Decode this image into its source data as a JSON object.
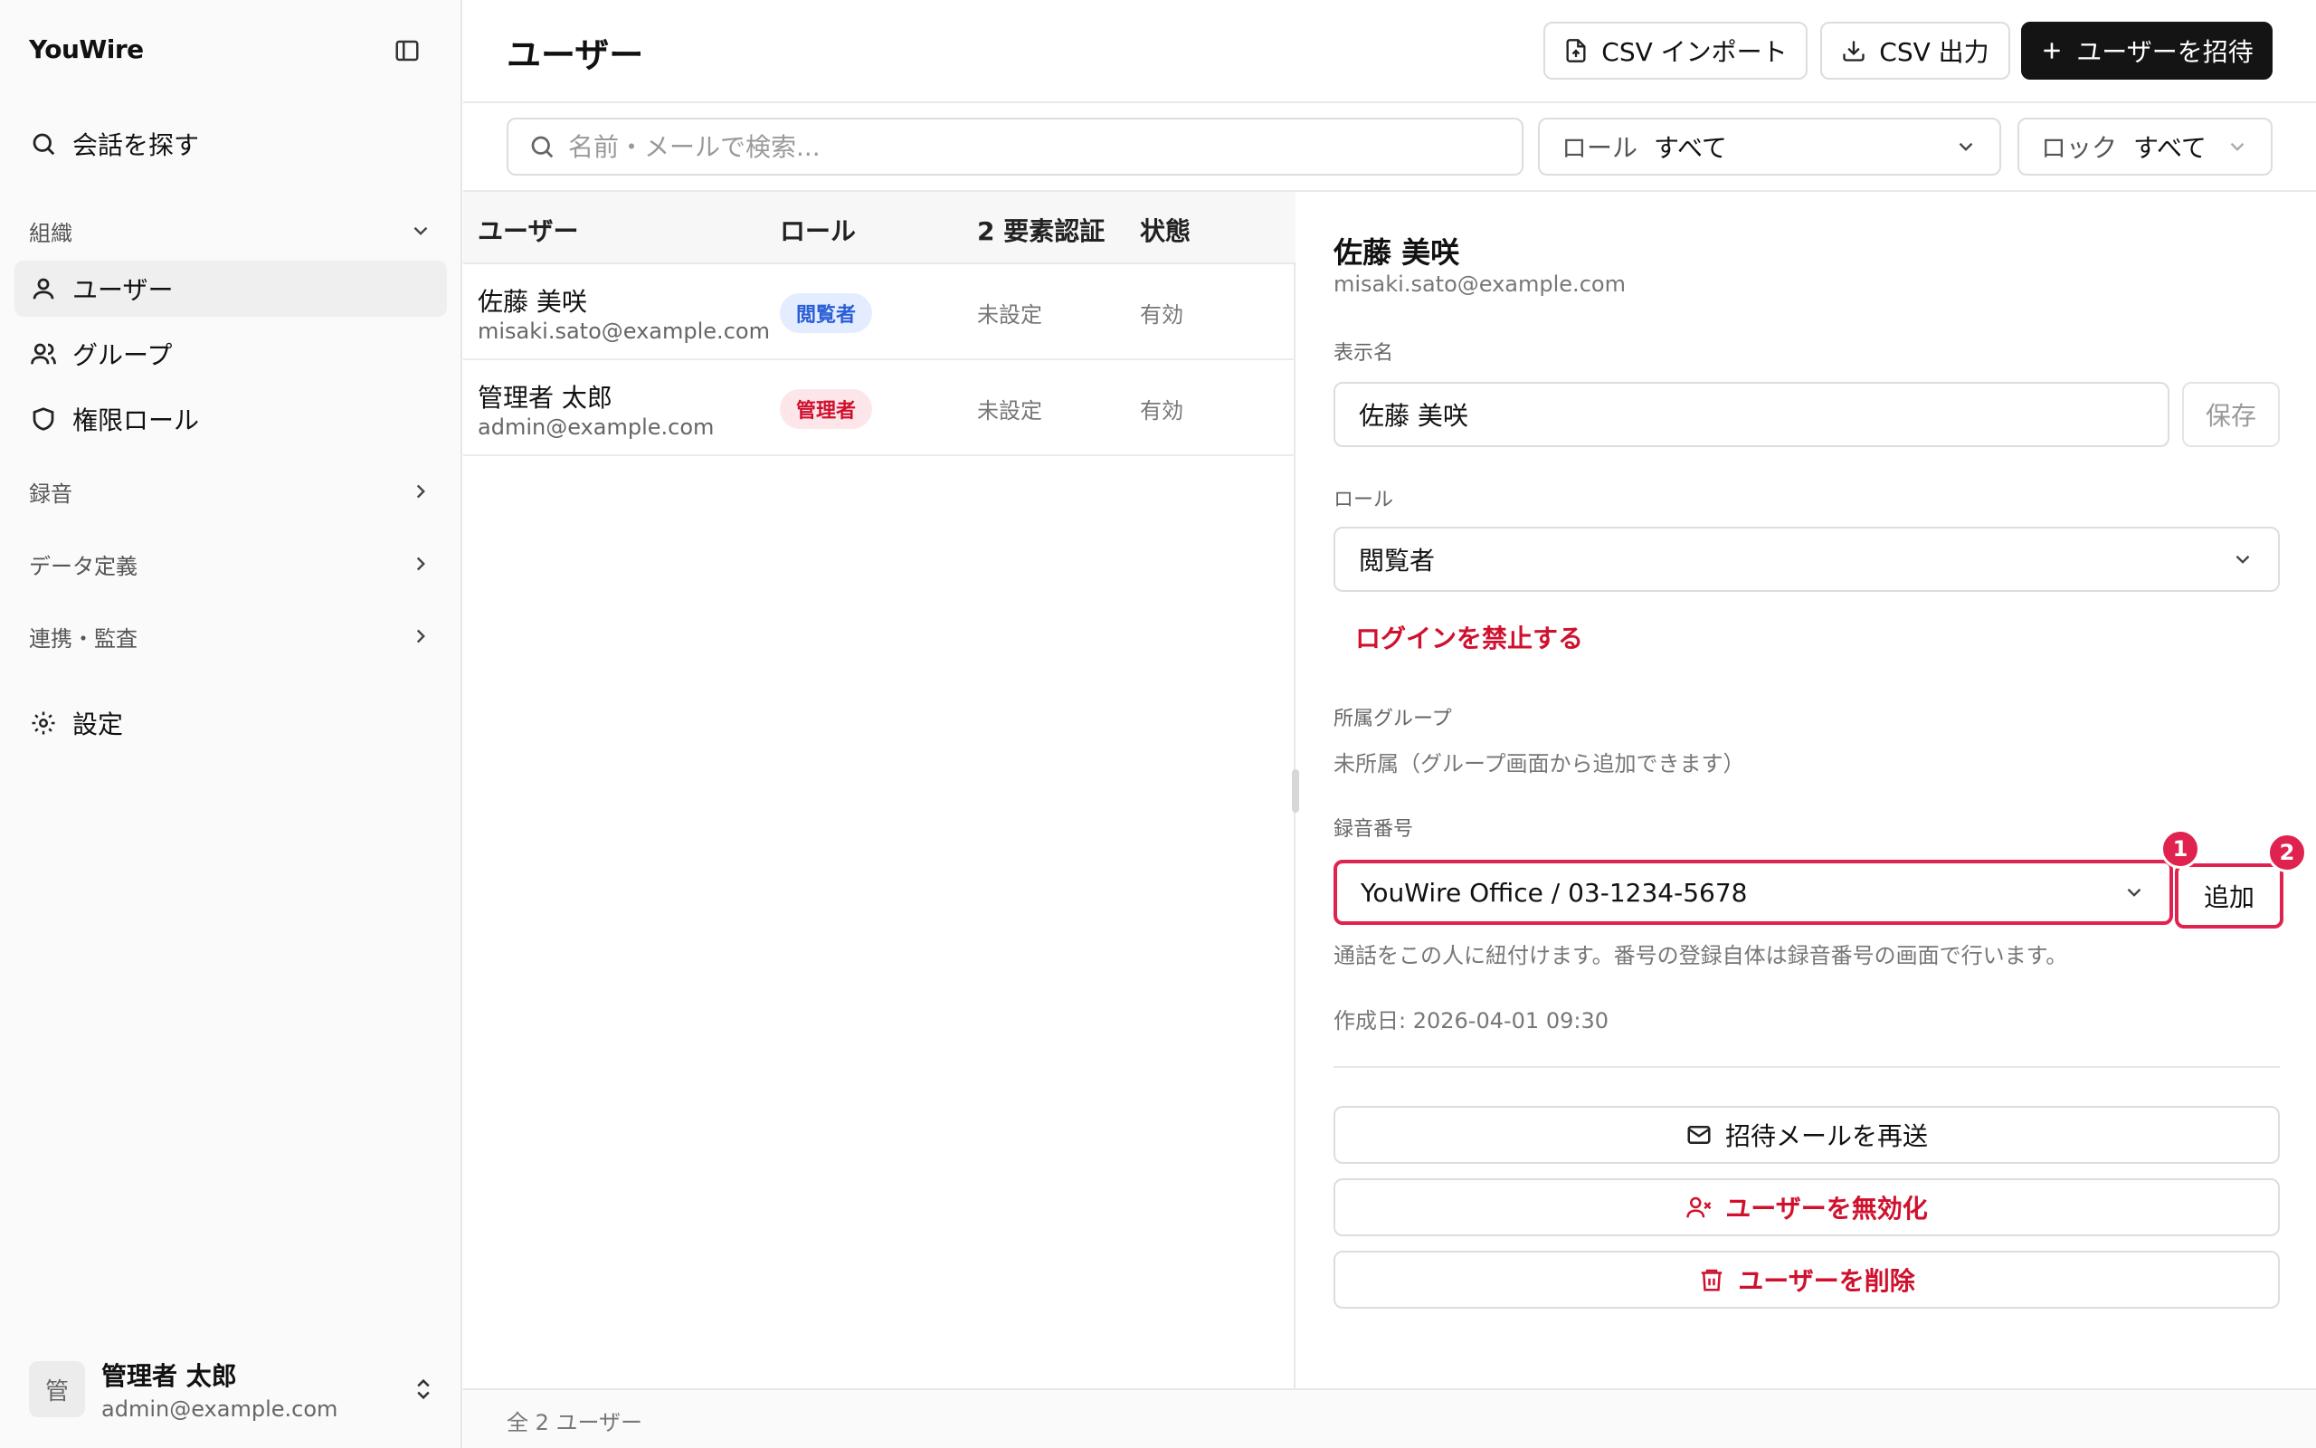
{
  "app": {
    "brand": "YouWire"
  },
  "sidebar": {
    "search_label": "会話を探す",
    "section_org": "組織",
    "items": [
      {
        "label": "ユーザー",
        "icon": "user-icon"
      },
      {
        "label": "グループ",
        "icon": "users-icon"
      },
      {
        "label": "権限ロール",
        "icon": "shield-icon"
      }
    ],
    "section_recording": "録音",
    "section_data": "データ定義",
    "section_integration": "連携・監査",
    "settings_label": "設定",
    "current_user": {
      "avatar": "管",
      "name": "管理者 太郎",
      "email": "admin@example.com"
    }
  },
  "header": {
    "title": "ユーザー",
    "import_label": "CSV インポート",
    "export_label": "CSV 出力",
    "invite_label": "ユーザーを招待"
  },
  "filters": {
    "search_placeholder": "名前・メールで検索...",
    "role_label": "ロール",
    "role_value": "すべて",
    "lock_label": "ロック",
    "lock_value": "すべて"
  },
  "table": {
    "columns": [
      "ユーザー",
      "ロール",
      "2 要素認証",
      "状態"
    ],
    "rows": [
      {
        "name": "佐藤 美咲",
        "email": "misaki.sato@example.com",
        "role": "閲覧者",
        "mfa": "未設定",
        "status": "有効"
      },
      {
        "name": "管理者 太郎",
        "email": "admin@example.com",
        "role": "管理者",
        "mfa": "未設定",
        "status": "有効"
      }
    ],
    "total": "全 2 ユーザー"
  },
  "detail": {
    "name": "佐藤 美咲",
    "email": "misaki.sato@example.com",
    "display_name_label": "表示名",
    "display_name_value": "佐藤 美咲",
    "save_label": "保存",
    "role_label": "ロール",
    "role_value": "閲覧者",
    "ban_login_label": "ログインを禁止する",
    "groups_label": "所属グループ",
    "groups_value": "未所属（グループ画面から追加できます）",
    "recording_label": "録音番号",
    "recording_value": "YouWire Office / 03-1234-5678",
    "add_label": "追加",
    "recording_hint": "通話をこの人に紐付けます。番号の登録自体は録音番号の画面で行います。",
    "created_at": "作成日: 2026-04-01 09:30",
    "resend_label": "招待メールを再送",
    "disable_label": "ユーザーを無効化",
    "delete_label": "ユーザーを削除"
  },
  "annotations": [
    "1",
    "2"
  ],
  "colors": {
    "accent": "#e0224f",
    "danger": "#d0112e",
    "viewer_badge": "#2b5fd6",
    "primary_button": "#141414"
  }
}
